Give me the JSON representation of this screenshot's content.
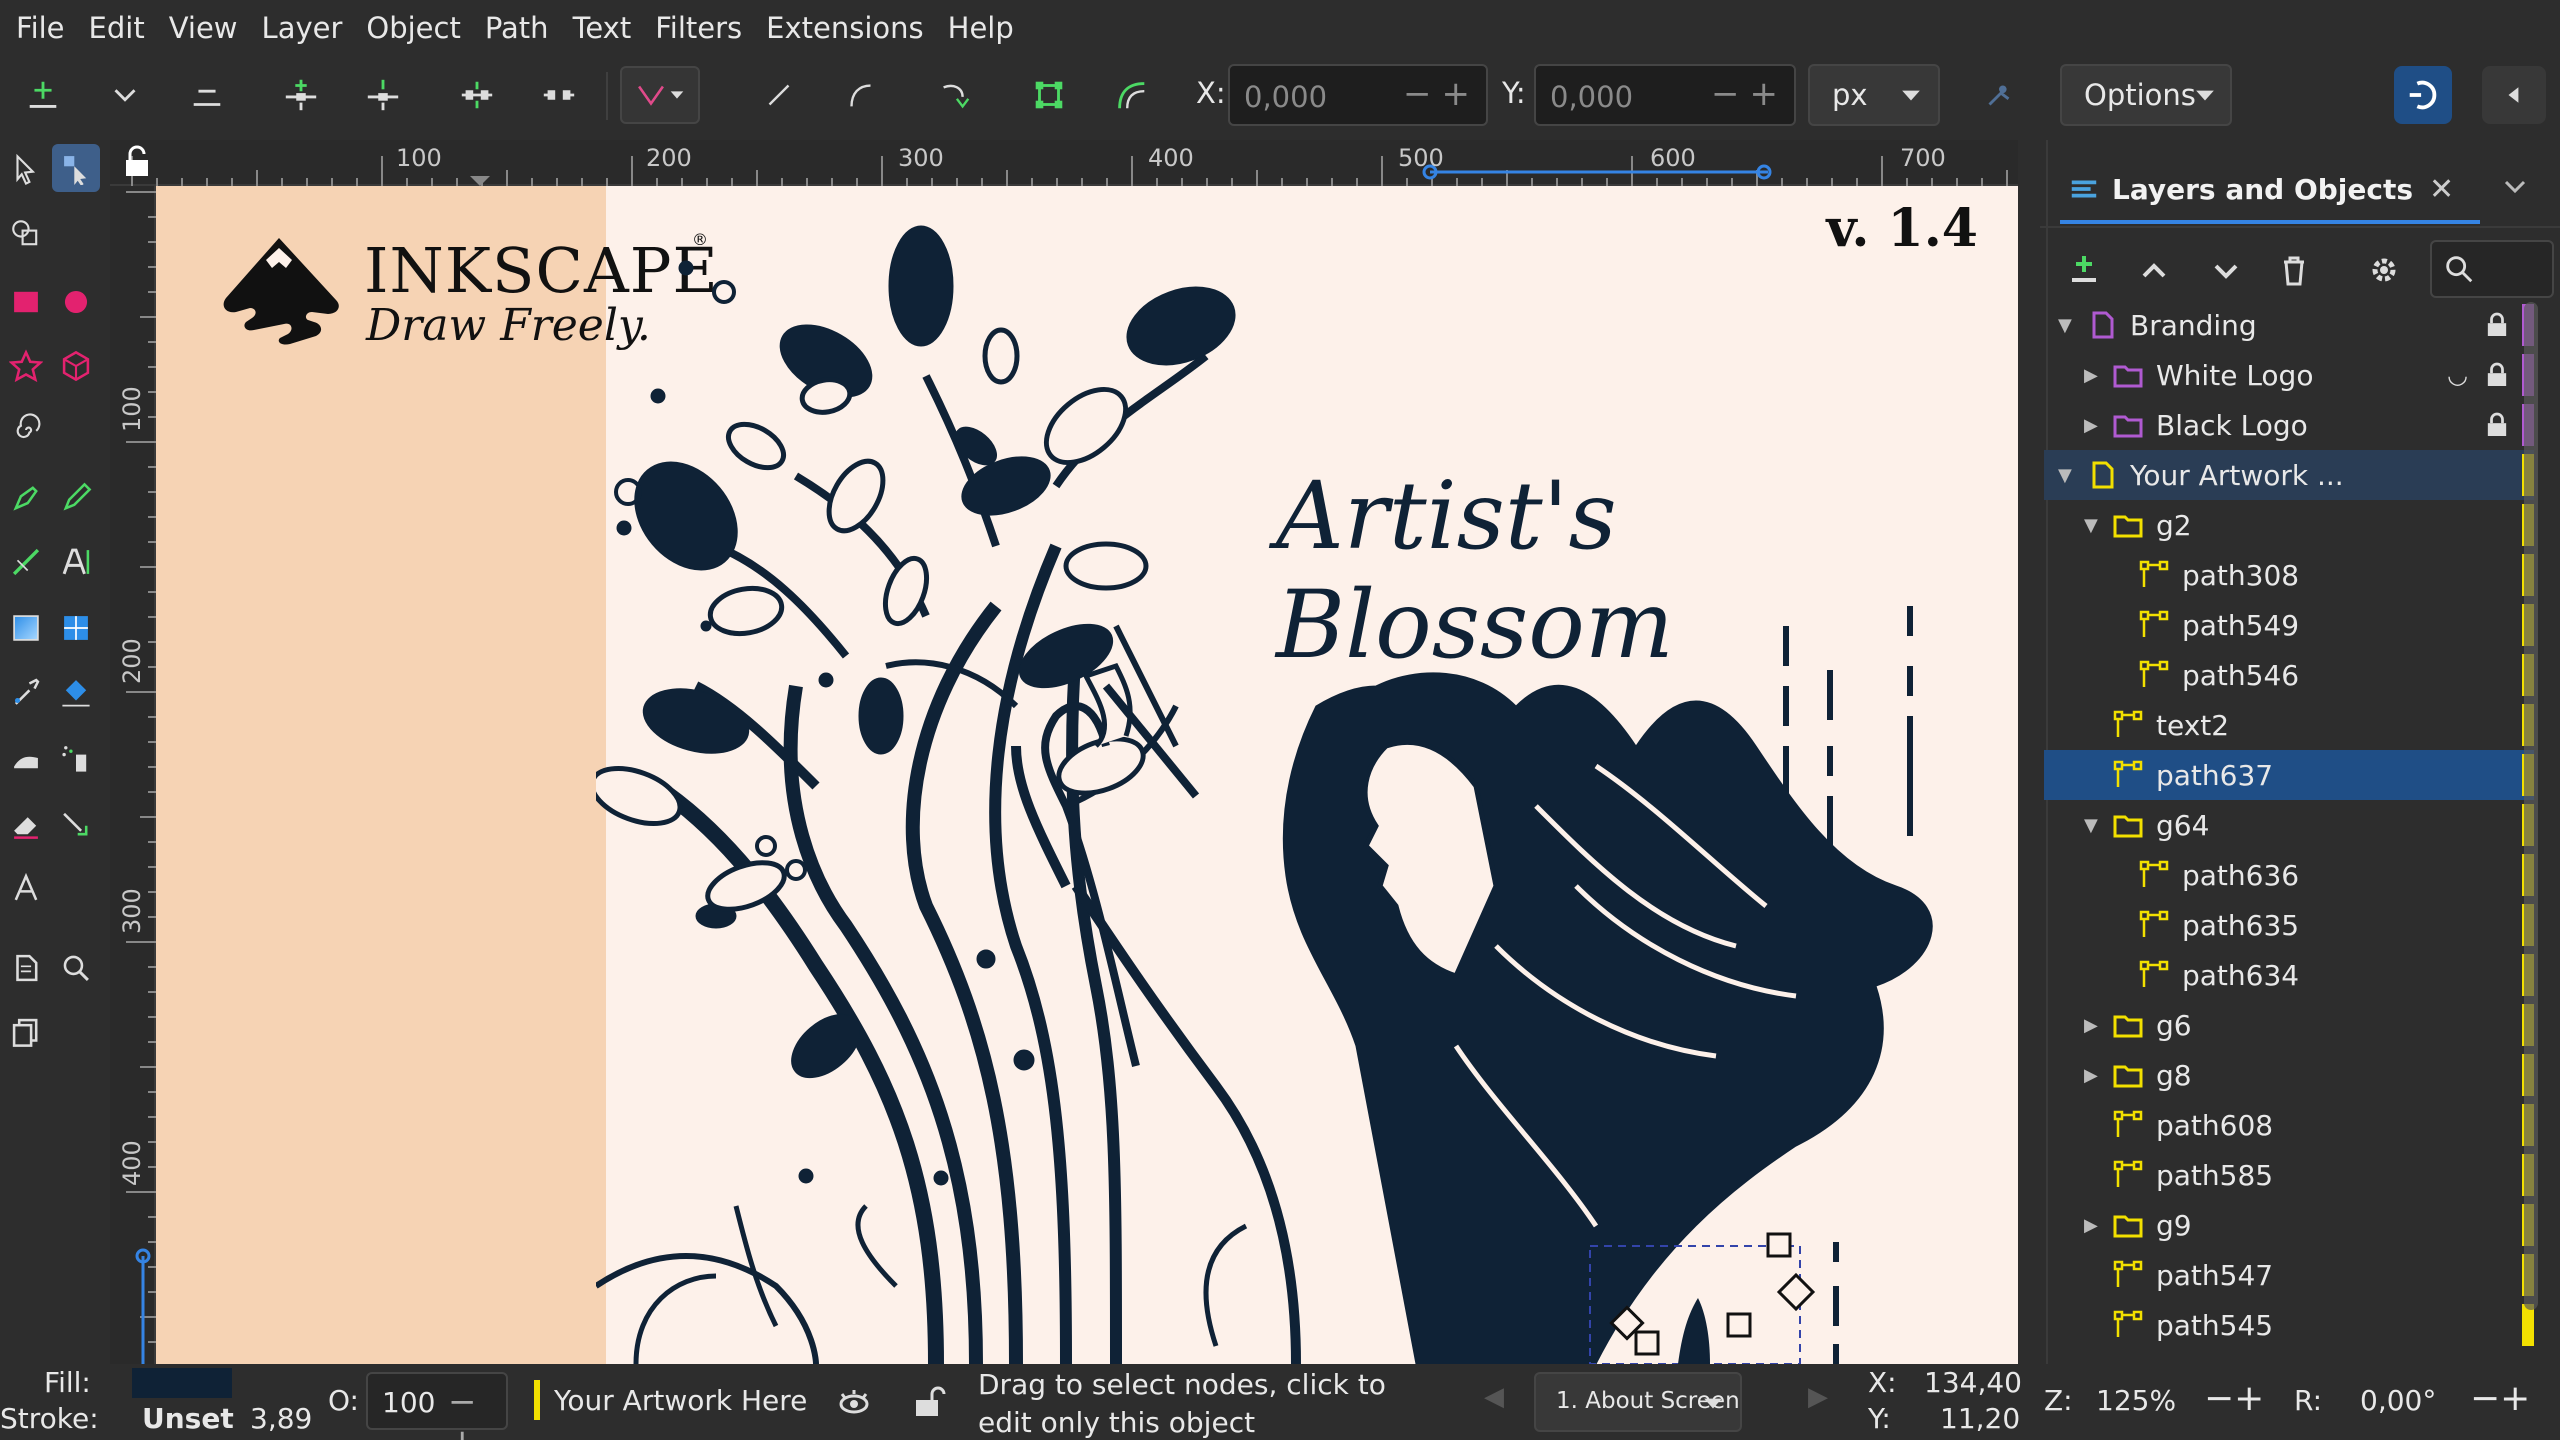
{
  "menu": [
    "File",
    "Edit",
    "View",
    "Layer",
    "Object",
    "Path",
    "Text",
    "Filters",
    "Extensions",
    "Help"
  ],
  "toolbar": {
    "x_label": "X:",
    "x_value": "0,000",
    "y_label": "Y:",
    "y_value": "0,000",
    "unit": "px",
    "options_label": "Options"
  },
  "rulers": {
    "h_ticks": [
      "100",
      "200",
      "300",
      "400",
      "500",
      "600",
      "700"
    ],
    "v_ticks": [
      "100",
      "200",
      "300",
      "400"
    ]
  },
  "artwork": {
    "logo_name": "INKSCAPE",
    "logo_reg": "®",
    "tagline": "Draw Freely.",
    "version": "v. 1.4",
    "title": "Artist's Blossom"
  },
  "dock": {
    "tab_title": "Layers and Objects",
    "colors": {
      "purple": "#b05ad1",
      "yellow": "#f2e000",
      "selection": "#1f4e86"
    },
    "rows": [
      {
        "label": "Branding",
        "type": "layer",
        "depth": 0,
        "expander": "open",
        "lock": true,
        "hidden": false,
        "color": "purple"
      },
      {
        "label": "White Logo",
        "type": "sublayer",
        "depth": 1,
        "expander": "closed",
        "lock": true,
        "hidden": true,
        "color": "purple"
      },
      {
        "label": "Black Logo",
        "type": "sublayer",
        "depth": 1,
        "expander": "closed",
        "lock": true,
        "hidden": false,
        "color": "purple"
      },
      {
        "label": "Your Artwork ...",
        "type": "layer",
        "depth": 0,
        "expander": "open",
        "lock": false,
        "hidden": false,
        "color": "yellow",
        "highlight": true
      },
      {
        "label": "g2",
        "type": "group",
        "depth": 1,
        "expander": "open",
        "color": "yellow"
      },
      {
        "label": "path308",
        "type": "path",
        "depth": 2,
        "color": "yellow"
      },
      {
        "label": "path549",
        "type": "path",
        "depth": 2,
        "color": "yellow"
      },
      {
        "label": "path546",
        "type": "path",
        "depth": 2,
        "color": "yellow"
      },
      {
        "label": "text2",
        "type": "path",
        "depth": 1,
        "color": "yellow"
      },
      {
        "label": "path637",
        "type": "path",
        "depth": 1,
        "color": "yellow",
        "selected": true
      },
      {
        "label": "g64",
        "type": "group",
        "depth": 1,
        "expander": "open",
        "color": "yellow"
      },
      {
        "label": "path636",
        "type": "path",
        "depth": 2,
        "color": "yellow"
      },
      {
        "label": "path635",
        "type": "path",
        "depth": 2,
        "color": "yellow"
      },
      {
        "label": "path634",
        "type": "path",
        "depth": 2,
        "color": "yellow"
      },
      {
        "label": "g6",
        "type": "group",
        "depth": 1,
        "expander": "closed",
        "color": "yellow"
      },
      {
        "label": "g8",
        "type": "group",
        "depth": 1,
        "expander": "closed",
        "color": "yellow"
      },
      {
        "label": "path608",
        "type": "path",
        "depth": 1,
        "color": "yellow"
      },
      {
        "label": "path585",
        "type": "path",
        "depth": 1,
        "color": "yellow"
      },
      {
        "label": "g9",
        "type": "group",
        "depth": 1,
        "expander": "closed",
        "color": "yellow"
      },
      {
        "label": "path547",
        "type": "path",
        "depth": 1,
        "color": "yellow"
      },
      {
        "label": "path545",
        "type": "path",
        "depth": 1,
        "color": "yellow"
      }
    ]
  },
  "status": {
    "fill_label": "Fill:",
    "stroke_label": "Stroke:",
    "stroke_value": "Unset",
    "stroke_width": "3,89",
    "opacity_label": "O:",
    "opacity_value": "100",
    "layer_name": "Your Artwork Here",
    "message": "Drag to select nodes, click to edit only this object",
    "page_select": "1. About Screen",
    "cursor_x_label": "X:",
    "cursor_x": "134,40",
    "cursor_y_label": "Y:",
    "cursor_y": "11,20",
    "zoom_label": "Z:",
    "zoom_value": "125%",
    "rotation_label": "R:",
    "rotation_value": "0,00°"
  }
}
